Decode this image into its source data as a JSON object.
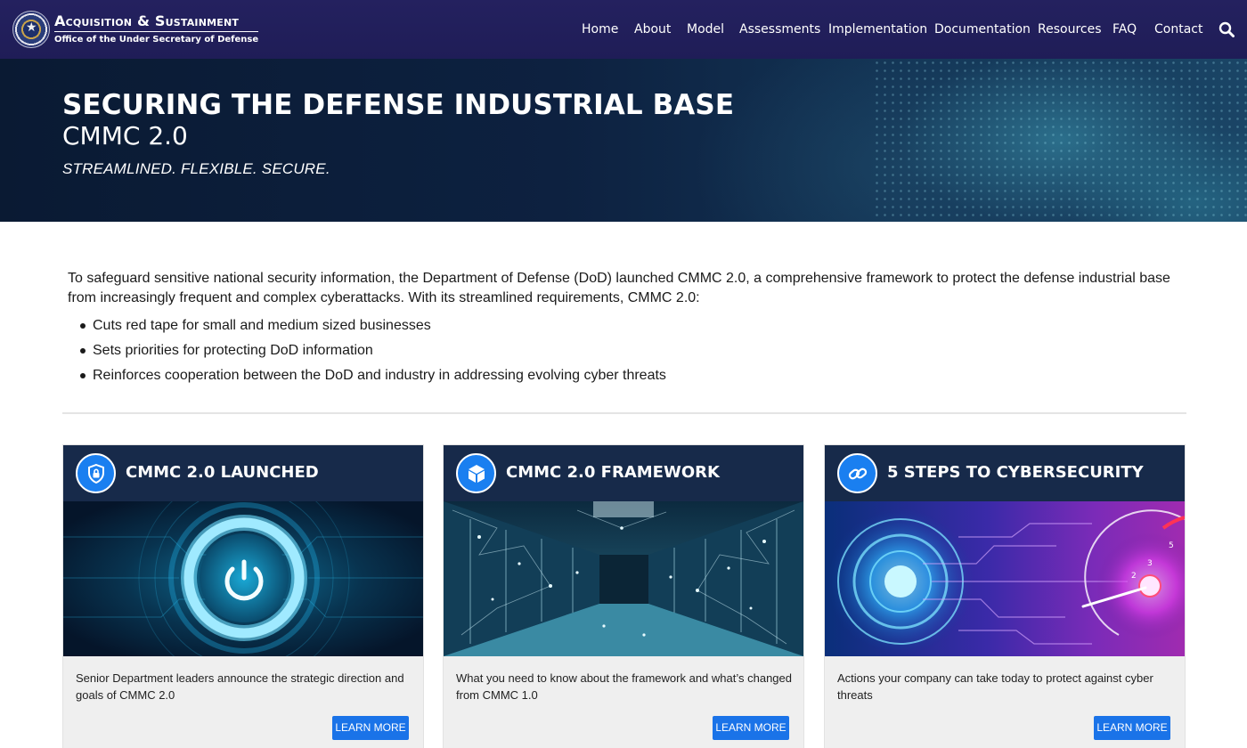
{
  "header": {
    "brand_title": "Acquisition & Sustainment",
    "brand_subtitle": "Office of the Under Secretary of Defense",
    "logo_icon": "dod-seal-icon",
    "nav_items": [
      "Home",
      "About",
      "Model",
      "Assessments",
      "Implementation",
      "Documentation",
      "Resources",
      "FAQ",
      "Contact"
    ],
    "search_icon": "search-icon",
    "background_color": "#23205e"
  },
  "hero": {
    "title": "SECURING THE DEFENSE INDUSTRIAL BASE",
    "subtitle": "CMMC 2.0",
    "tagline": "STREAMLINED. FLEXIBLE. SECURE."
  },
  "intro": {
    "paragraph": "To safeguard sensitive national security information, the Department of Defense (DoD) launched CMMC 2.0, a comprehensive framework to protect the defense industrial base from increasingly frequent and complex cyberattacks. With its streamlined requirements, CMMC 2.0:",
    "bullets": [
      "Cuts red tape for small and medium sized businesses",
      "Sets priorities for protecting DoD information",
      "Reinforces cooperation between the DoD and industry in addressing evolving cyber threats"
    ]
  },
  "cards": [
    {
      "title": "CMMC 2.0 LAUNCHED",
      "icon": "shield-lock-icon",
      "image": "power-button-image",
      "description": "Senior Department leaders announce the strategic direction and goals of CMMC 2.0",
      "button": "LEARN MORE"
    },
    {
      "title": "CMMC 2.0 FRAMEWORK",
      "icon": "cube-icon",
      "image": "data-center-image",
      "description": "What you need to know about the framework and what’s changed from CMMC 1.0",
      "button": "LEARN MORE"
    },
    {
      "title": "5 STEPS TO CYBERSECURITY",
      "icon": "link-icon",
      "image": "speedometer-circuit-image",
      "description": "Actions your company can take today to protect against cyber threats",
      "button": "LEARN MORE"
    }
  ],
  "colors": {
    "card_header": "#172a4a",
    "accent_blue": "#1a73e8",
    "card_body": "#efefef"
  }
}
